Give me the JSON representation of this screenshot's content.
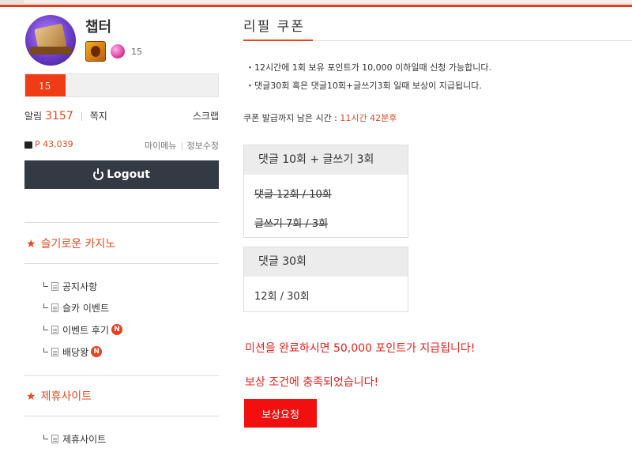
{
  "profile": {
    "username": "챕터",
    "level": "15",
    "level_progress_percent": 21
  },
  "stats": {
    "alarm_label": "알림",
    "alarm_count": "3157",
    "note_label": "쪽지",
    "scrap_label": "스크랩",
    "points_label": "P 43,039",
    "my_menu_label": "마이메뉴",
    "edit_info_label": "정보수정"
  },
  "logout_label": "Logout",
  "sidebar": {
    "section1_title": "슬기로운 카지노",
    "section1_items": [
      {
        "label": "공지사항",
        "new": false
      },
      {
        "label": "슬카 이벤트",
        "new": false
      },
      {
        "label": "이벤트 후기",
        "new": true
      },
      {
        "label": "배당왕",
        "new": true
      }
    ],
    "new_badge": "N",
    "section2_title": "제휴사이트",
    "section2_items": [
      {
        "label": "제휴사이트"
      }
    ]
  },
  "main": {
    "title": "리필 쿠폰",
    "notices": [
      "・12시간에 1회 보유 포인트가 10,000 이하일때 신청 가능합니다.",
      "・댓글30회 혹은 댓글10회+글쓰기3회 일때 보상이 지급됩니다."
    ],
    "remaining_label": "쿠폰 발급까지 남은 시간 : ",
    "remaining_time": "11시간 42분후",
    "mission1": {
      "title": "댓글 10회 + 글쓰기 3회",
      "lines": [
        "댓글 12회 / 10회",
        "글쓰기 7회 / 3회"
      ]
    },
    "mission2": {
      "title": "댓글 30회",
      "lines": [
        "12회 / 30회"
      ]
    },
    "reward_message": "미션을 완료하시면 50,000 포인트가 지급됩니다!",
    "status_message": "보상 조건에 충족되었습니다!",
    "claim_button": "보상요청"
  },
  "colors": {
    "accent": "#e04a1e",
    "button_red": "#f20f0f",
    "logout_bg": "#333a43"
  }
}
